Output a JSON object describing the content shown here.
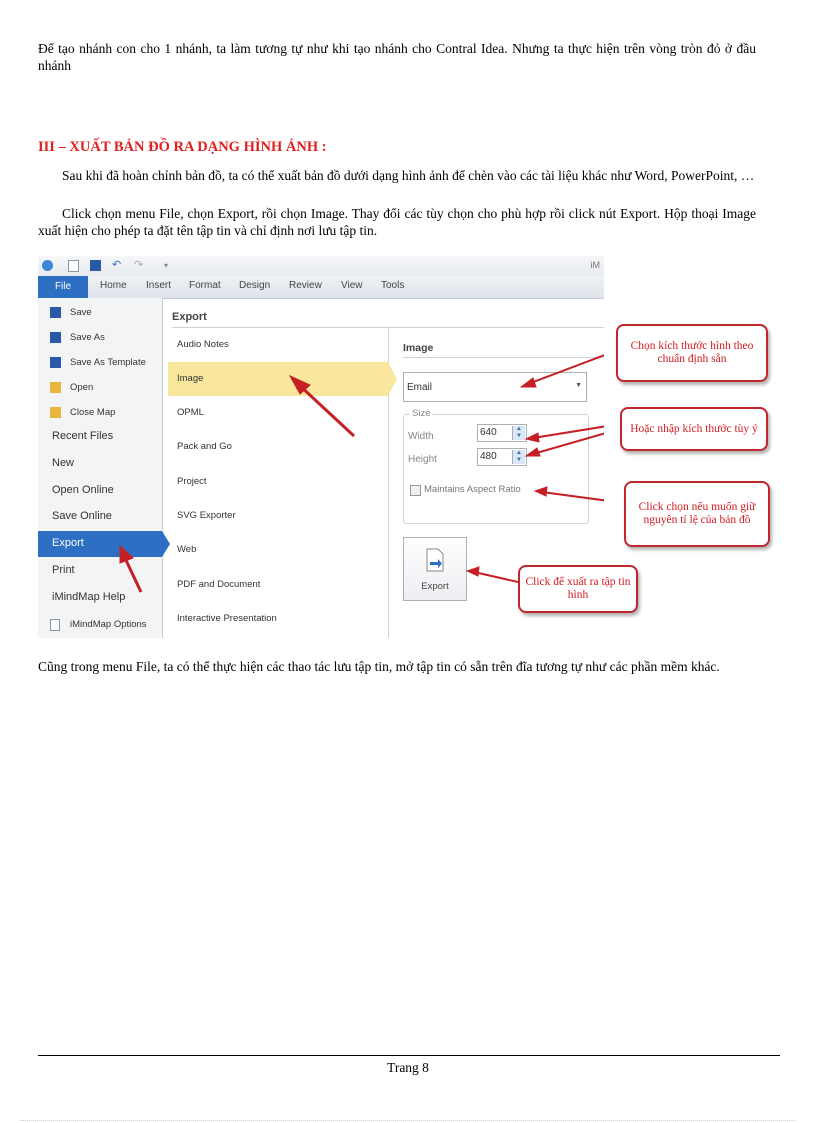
{
  "paragraphs": {
    "p1": "Để tạo nhánh con cho 1 nhánh, ta làm tương tự như khi tạo nhánh cho Contral Idea. Nhưng ta thực hiện trên vòng tròn đỏ ở đầu nhánh",
    "heading": "III – XUẤT BẢN ĐỒ RA DẠNG HÌNH ẢNH :",
    "p2": "Sau khi đã hoàn chỉnh bản đồ, ta có thể xuất bản đồ dưới dạng hình ảnh để chèn vào các tài liệu khác như Word, PowerPoint, …",
    "p3": "Click chọn menu File, chọn Export, rồi chọn Image. Thay đổi các tùy chọn cho phù hợp rồi click nút Export. Hộp thoại Image xuất hiện cho phép ta đặt tên tập tin và chỉ định nơi lưu tập tin.",
    "p4": "Cũng trong menu File, ta có thể thực hiện các thao tác lưu tập tin, mở tập tin có sẵn trên đĩa tương tự như các phần mềm khác."
  },
  "screenshot": {
    "window_title": "iM",
    "ribbon_tabs": [
      "File",
      "Home",
      "Insert",
      "Format",
      "Design",
      "Review",
      "View",
      "Tools"
    ],
    "sidebar": [
      "Save",
      "Save As",
      "Save As Template",
      "Open",
      "Close Map",
      "Recent Files",
      "New",
      "Open Online",
      "Save Online",
      "Export",
      "Print",
      "iMindMap Help",
      "iMindMap Options"
    ],
    "export_title": "Export",
    "export_options": [
      "Audio Notes",
      "Image",
      "OPML",
      "Pack and Go",
      "Project",
      "SVG Exporter",
      "Web",
      "PDF and Document",
      "Interactive Presentation"
    ],
    "panel_title": "Image",
    "preset_value": "Email",
    "size_label": "Size",
    "width_label": "Width",
    "width_value": "640",
    "height_label": "Height",
    "height_value": "480",
    "aspect_label": "Maintains Aspect Ratio",
    "export_button": "Export",
    "callouts": {
      "preset": "Chọn kích thước hình theo chuẩn định sẵn",
      "size": "Hoặc nhập kích thước tùy ý",
      "aspect": "Click chọn nếu muốn giữ nguyên tỉ lệ của bản đồ",
      "export": "Click để xuất ra tập tin hình"
    },
    "colors": {
      "file_tab": "#2d6fc2",
      "selected_item": "#f8e79c",
      "callout": "#c0272d",
      "arrow": "#c62026"
    }
  },
  "footer": {
    "page": "Trang 8"
  }
}
